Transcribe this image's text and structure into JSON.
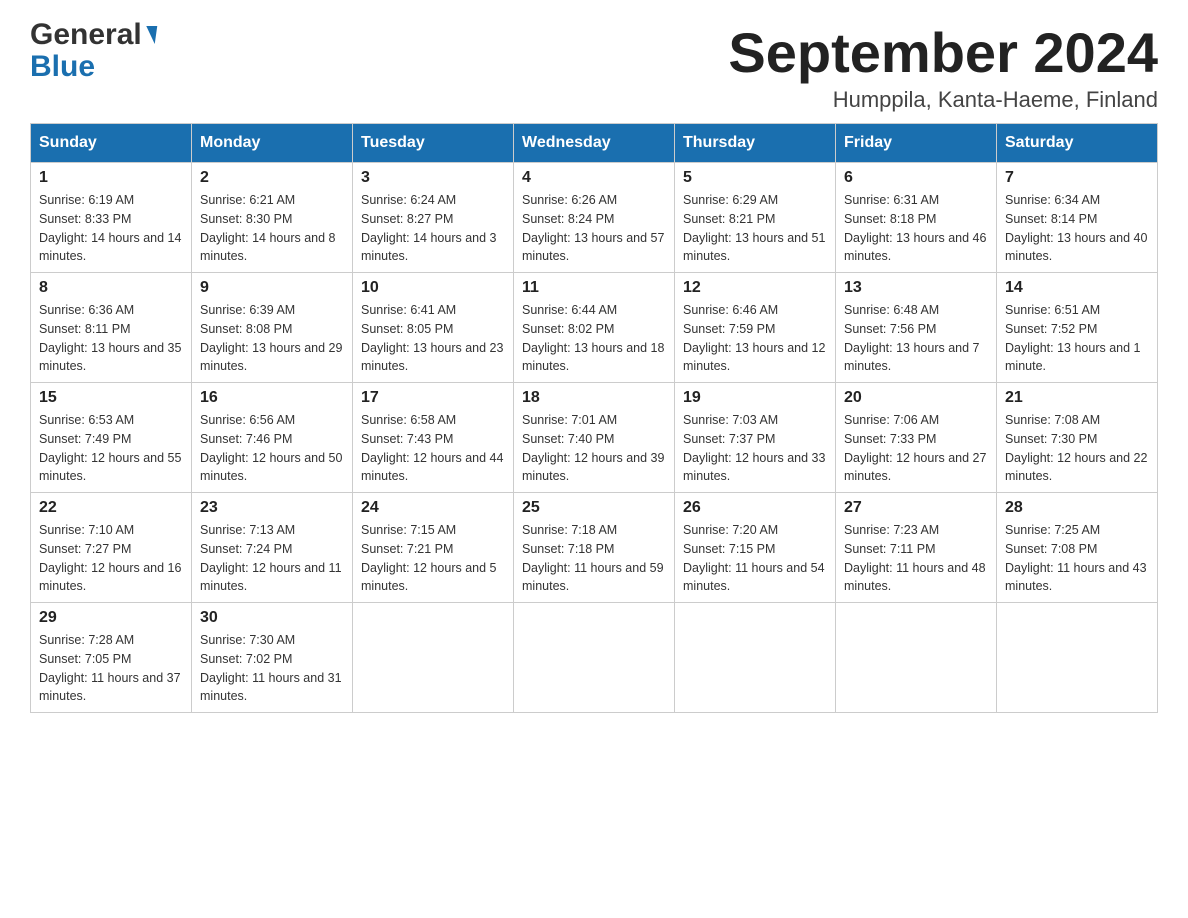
{
  "header": {
    "month_year": "September 2024",
    "location": "Humppila, Kanta-Haeme, Finland",
    "logo_line1": "General",
    "logo_line2": "Blue"
  },
  "weekdays": [
    "Sunday",
    "Monday",
    "Tuesday",
    "Wednesday",
    "Thursday",
    "Friday",
    "Saturday"
  ],
  "weeks": [
    [
      {
        "day": "1",
        "sunrise": "Sunrise: 6:19 AM",
        "sunset": "Sunset: 8:33 PM",
        "daylight": "Daylight: 14 hours and 14 minutes."
      },
      {
        "day": "2",
        "sunrise": "Sunrise: 6:21 AM",
        "sunset": "Sunset: 8:30 PM",
        "daylight": "Daylight: 14 hours and 8 minutes."
      },
      {
        "day": "3",
        "sunrise": "Sunrise: 6:24 AM",
        "sunset": "Sunset: 8:27 PM",
        "daylight": "Daylight: 14 hours and 3 minutes."
      },
      {
        "day": "4",
        "sunrise": "Sunrise: 6:26 AM",
        "sunset": "Sunset: 8:24 PM",
        "daylight": "Daylight: 13 hours and 57 minutes."
      },
      {
        "day": "5",
        "sunrise": "Sunrise: 6:29 AM",
        "sunset": "Sunset: 8:21 PM",
        "daylight": "Daylight: 13 hours and 51 minutes."
      },
      {
        "day": "6",
        "sunrise": "Sunrise: 6:31 AM",
        "sunset": "Sunset: 8:18 PM",
        "daylight": "Daylight: 13 hours and 46 minutes."
      },
      {
        "day": "7",
        "sunrise": "Sunrise: 6:34 AM",
        "sunset": "Sunset: 8:14 PM",
        "daylight": "Daylight: 13 hours and 40 minutes."
      }
    ],
    [
      {
        "day": "8",
        "sunrise": "Sunrise: 6:36 AM",
        "sunset": "Sunset: 8:11 PM",
        "daylight": "Daylight: 13 hours and 35 minutes."
      },
      {
        "day": "9",
        "sunrise": "Sunrise: 6:39 AM",
        "sunset": "Sunset: 8:08 PM",
        "daylight": "Daylight: 13 hours and 29 minutes."
      },
      {
        "day": "10",
        "sunrise": "Sunrise: 6:41 AM",
        "sunset": "Sunset: 8:05 PM",
        "daylight": "Daylight: 13 hours and 23 minutes."
      },
      {
        "day": "11",
        "sunrise": "Sunrise: 6:44 AM",
        "sunset": "Sunset: 8:02 PM",
        "daylight": "Daylight: 13 hours and 18 minutes."
      },
      {
        "day": "12",
        "sunrise": "Sunrise: 6:46 AM",
        "sunset": "Sunset: 7:59 PM",
        "daylight": "Daylight: 13 hours and 12 minutes."
      },
      {
        "day": "13",
        "sunrise": "Sunrise: 6:48 AM",
        "sunset": "Sunset: 7:56 PM",
        "daylight": "Daylight: 13 hours and 7 minutes."
      },
      {
        "day": "14",
        "sunrise": "Sunrise: 6:51 AM",
        "sunset": "Sunset: 7:52 PM",
        "daylight": "Daylight: 13 hours and 1 minute."
      }
    ],
    [
      {
        "day": "15",
        "sunrise": "Sunrise: 6:53 AM",
        "sunset": "Sunset: 7:49 PM",
        "daylight": "Daylight: 12 hours and 55 minutes."
      },
      {
        "day": "16",
        "sunrise": "Sunrise: 6:56 AM",
        "sunset": "Sunset: 7:46 PM",
        "daylight": "Daylight: 12 hours and 50 minutes."
      },
      {
        "day": "17",
        "sunrise": "Sunrise: 6:58 AM",
        "sunset": "Sunset: 7:43 PM",
        "daylight": "Daylight: 12 hours and 44 minutes."
      },
      {
        "day": "18",
        "sunrise": "Sunrise: 7:01 AM",
        "sunset": "Sunset: 7:40 PM",
        "daylight": "Daylight: 12 hours and 39 minutes."
      },
      {
        "day": "19",
        "sunrise": "Sunrise: 7:03 AM",
        "sunset": "Sunset: 7:37 PM",
        "daylight": "Daylight: 12 hours and 33 minutes."
      },
      {
        "day": "20",
        "sunrise": "Sunrise: 7:06 AM",
        "sunset": "Sunset: 7:33 PM",
        "daylight": "Daylight: 12 hours and 27 minutes."
      },
      {
        "day": "21",
        "sunrise": "Sunrise: 7:08 AM",
        "sunset": "Sunset: 7:30 PM",
        "daylight": "Daylight: 12 hours and 22 minutes."
      }
    ],
    [
      {
        "day": "22",
        "sunrise": "Sunrise: 7:10 AM",
        "sunset": "Sunset: 7:27 PM",
        "daylight": "Daylight: 12 hours and 16 minutes."
      },
      {
        "day": "23",
        "sunrise": "Sunrise: 7:13 AM",
        "sunset": "Sunset: 7:24 PM",
        "daylight": "Daylight: 12 hours and 11 minutes."
      },
      {
        "day": "24",
        "sunrise": "Sunrise: 7:15 AM",
        "sunset": "Sunset: 7:21 PM",
        "daylight": "Daylight: 12 hours and 5 minutes."
      },
      {
        "day": "25",
        "sunrise": "Sunrise: 7:18 AM",
        "sunset": "Sunset: 7:18 PM",
        "daylight": "Daylight: 11 hours and 59 minutes."
      },
      {
        "day": "26",
        "sunrise": "Sunrise: 7:20 AM",
        "sunset": "Sunset: 7:15 PM",
        "daylight": "Daylight: 11 hours and 54 minutes."
      },
      {
        "day": "27",
        "sunrise": "Sunrise: 7:23 AM",
        "sunset": "Sunset: 7:11 PM",
        "daylight": "Daylight: 11 hours and 48 minutes."
      },
      {
        "day": "28",
        "sunrise": "Sunrise: 7:25 AM",
        "sunset": "Sunset: 7:08 PM",
        "daylight": "Daylight: 11 hours and 43 minutes."
      }
    ],
    [
      {
        "day": "29",
        "sunrise": "Sunrise: 7:28 AM",
        "sunset": "Sunset: 7:05 PM",
        "daylight": "Daylight: 11 hours and 37 minutes."
      },
      {
        "day": "30",
        "sunrise": "Sunrise: 7:30 AM",
        "sunset": "Sunset: 7:02 PM",
        "daylight": "Daylight: 11 hours and 31 minutes."
      },
      null,
      null,
      null,
      null,
      null
    ]
  ]
}
